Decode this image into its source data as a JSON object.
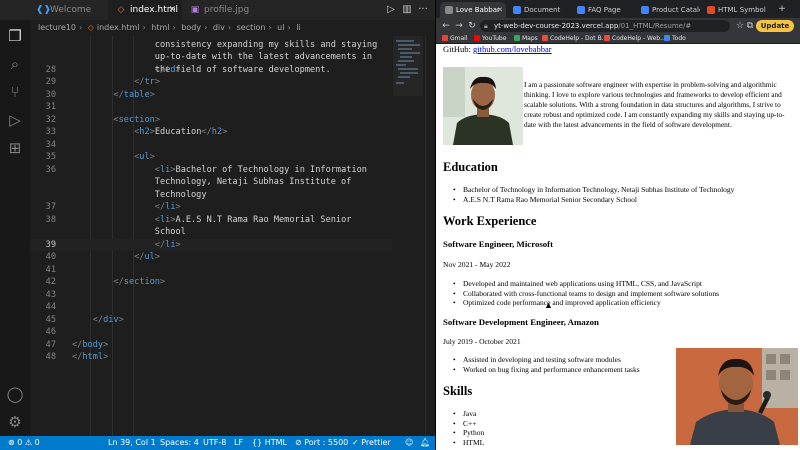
{
  "vscode": {
    "tabs": [
      {
        "label": "Welcome",
        "icon": "vscode-icon",
        "active": false
      },
      {
        "label": "index.html",
        "icon": "html-file-icon",
        "active": true
      },
      {
        "label": "profile.jpg",
        "icon": "image-file-icon",
        "active": false
      }
    ],
    "breadcrumb": [
      "lecture10",
      "index.html",
      "html",
      "body",
      "div",
      "section",
      "ul",
      "li"
    ],
    "code_lines": [
      {
        "n": "28",
        "parts": [
          [
            "                ",
            ""
          ],
          [
            "</",
            "pn"
          ],
          [
            "td",
            "tg"
          ],
          [
            ">",
            "pn"
          ]
        ]
      },
      {
        "n": "29",
        "parts": [
          [
            "            ",
            ""
          ],
          [
            "</",
            "pn"
          ],
          [
            "tr",
            "tg"
          ],
          [
            ">",
            "pn"
          ]
        ]
      },
      {
        "n": "30",
        "parts": [
          [
            "        ",
            ""
          ],
          [
            "</",
            "pn"
          ],
          [
            "table",
            "tg"
          ],
          [
            ">",
            "pn"
          ]
        ]
      },
      {
        "n": "31",
        "parts": [
          [
            "",
            ""
          ]
        ]
      },
      {
        "n": "32",
        "parts": [
          [
            "        ",
            ""
          ],
          [
            "<",
            "pn"
          ],
          [
            "section",
            "tg"
          ],
          [
            ">",
            "pn"
          ]
        ]
      },
      {
        "n": "33",
        "parts": [
          [
            "            ",
            ""
          ],
          [
            "<",
            "pn"
          ],
          [
            "h2",
            "tg"
          ],
          [
            ">",
            "pn"
          ],
          [
            "Education",
            ""
          ],
          [
            "</",
            "pn"
          ],
          [
            "h2",
            "tg"
          ],
          [
            ">",
            "pn"
          ]
        ]
      },
      {
        "n": "34",
        "parts": [
          [
            "",
            ""
          ]
        ]
      },
      {
        "n": "35",
        "parts": [
          [
            "            ",
            ""
          ],
          [
            "<",
            "pn"
          ],
          [
            "ul",
            "tg"
          ],
          [
            ">",
            "pn"
          ]
        ]
      },
      {
        "n": "36",
        "parts": [
          [
            "                ",
            ""
          ],
          [
            "<",
            "pn"
          ],
          [
            "li",
            "tg"
          ],
          [
            ">",
            "pn"
          ],
          [
            "Bachelor of Technology in Information",
            ""
          ]
        ]
      },
      {
        "n": "",
        "parts": [
          [
            "                Technology, Netaji Subhas Institute of",
            ""
          ]
        ]
      },
      {
        "n": "",
        "parts": [
          [
            "                Technology",
            ""
          ]
        ]
      },
      {
        "n": "37",
        "parts": [
          [
            "                ",
            ""
          ],
          [
            "</",
            "pn"
          ],
          [
            "li",
            "tg"
          ],
          [
            ">",
            "pn"
          ]
        ]
      },
      {
        "n": "38",
        "parts": [
          [
            "                ",
            ""
          ],
          [
            "<",
            "pn"
          ],
          [
            "li",
            "tg"
          ],
          [
            ">",
            "pn"
          ],
          [
            "A.E.S N.T Rama Rao Memorial Senior",
            ""
          ]
        ]
      },
      {
        "n": "",
        "parts": [
          [
            "                School",
            ""
          ]
        ]
      },
      {
        "n": "39",
        "current": true,
        "parts": [
          [
            "                ",
            ""
          ],
          [
            "</",
            "pn"
          ],
          [
            "li",
            "tg"
          ],
          [
            ">",
            "pn"
          ]
        ]
      },
      {
        "n": "40",
        "parts": [
          [
            "            ",
            ""
          ],
          [
            "</",
            "pn"
          ],
          [
            "ul",
            "tg"
          ],
          [
            ">",
            "pn"
          ]
        ]
      },
      {
        "n": "41",
        "parts": [
          [
            "",
            ""
          ]
        ]
      },
      {
        "n": "42",
        "parts": [
          [
            "        ",
            ""
          ],
          [
            "</",
            "pn"
          ],
          [
            "section",
            "tg"
          ],
          [
            ">",
            "pn"
          ]
        ]
      },
      {
        "n": "43",
        "parts": [
          [
            "",
            ""
          ]
        ]
      },
      {
        "n": "44",
        "parts": [
          [
            "",
            ""
          ]
        ]
      },
      {
        "n": "45",
        "parts": [
          [
            "    ",
            ""
          ],
          [
            "</",
            "pn"
          ],
          [
            "div",
            "tg"
          ],
          [
            ">",
            "pn"
          ]
        ]
      },
      {
        "n": "46",
        "parts": [
          [
            "",
            ""
          ]
        ]
      },
      {
        "n": "47",
        "parts": [
          [
            "",
            ""
          ],
          [
            "</",
            "pn"
          ],
          [
            "body",
            "tg"
          ],
          [
            ">",
            "pn"
          ]
        ]
      },
      {
        "n": "48",
        "parts": [
          [
            "",
            ""
          ],
          [
            "</",
            "pn"
          ],
          [
            "html",
            "tg"
          ],
          [
            ">",
            "pn"
          ]
        ]
      }
    ],
    "code_top_partial": [
      "                consistency expanding my skills and staying",
      "                up-to-date with the latest advancements in",
      "                the field of software development."
    ],
    "statusbar": {
      "problems": "⊗ 0  ⚠ 0",
      "position": "Ln 39, Col 1",
      "spaces": "Spaces: 4",
      "encoding": "UTF-8",
      "eol": "LF",
      "language": "{} HTML",
      "port": "⊘ Port : 5500",
      "prettier": "✓ Prettier"
    },
    "colors": {
      "statusbar": "#007acc",
      "tag": "#569cd6",
      "editor_bg": "#1e1e1e"
    }
  },
  "browser": {
    "tabs": [
      {
        "label": "Love Babbar",
        "active": true,
        "favicon_color": "#888888"
      },
      {
        "label": "Document",
        "active": false,
        "favicon_color": "#4285f4"
      },
      {
        "label": "FAQ Page",
        "active": false,
        "favicon_color": "#4285f4"
      },
      {
        "label": "Product Catalo",
        "active": false,
        "favicon_color": "#4285f4"
      },
      {
        "label": "HTML Symbols",
        "active": false,
        "favicon_color": "#e34c26"
      }
    ],
    "url_host": "yt-web-dev-course-2023.vercel.app",
    "url_path": "/01_HTML/Resume/#",
    "update_label": "Update",
    "bookmarks": [
      {
        "label": "Gmail",
        "color": "#ea4335"
      },
      {
        "label": "YouTube",
        "color": "#ff0000"
      },
      {
        "label": "Maps",
        "color": "#34a853"
      },
      {
        "label": "CodeHelp - Dot B...",
        "color": "#e74c3c"
      },
      {
        "label": "CodeHelp - Web...",
        "color": "#e74c3c"
      },
      {
        "label": "Todo",
        "color": "#4285f4"
      }
    ]
  },
  "resume": {
    "github_label": "GitHub:",
    "github_link": "github.com/lovebabbar",
    "bio": "I am a passionate software engineer with expertise in problem-solving and algorithmic thinking. I love to explore various technologies and frameworks to develop efficient and scalable solutions. With a strong foundation in data structures and algorithms, I strive to create robust and optimized code. I am constantly expanding my skills and staying up-to-date with the latest advancements in the field of software development.",
    "education_heading": "Education",
    "education": [
      "Bachelor of Technology in Information Technology, Netaji Subhas Institute of Technology",
      "A.E.S N.T Rama Rao Memorial Senior Secondary School"
    ],
    "work_heading": "Work Experience",
    "jobs": [
      {
        "title": "Software Engineer, Microsoft",
        "dates": "Nov 2021 - May 2022",
        "items": [
          "Developed and maintained web applications using HTML, CSS, and JavaScript",
          "Collaborated with cross-functional teams to design and implement software solutions",
          "Optimized code performance and improved application efficiency"
        ]
      },
      {
        "title": "Software Development Engineer, Amazon",
        "dates": "July 2019 - October 2021",
        "items": [
          "Assisted in developing and testing software modules",
          "Worked on bug fixing and performance enhancement tasks"
        ]
      }
    ],
    "skills_heading": "Skills",
    "skills": [
      "Java",
      "C++",
      "Python",
      "HTML"
    ]
  }
}
